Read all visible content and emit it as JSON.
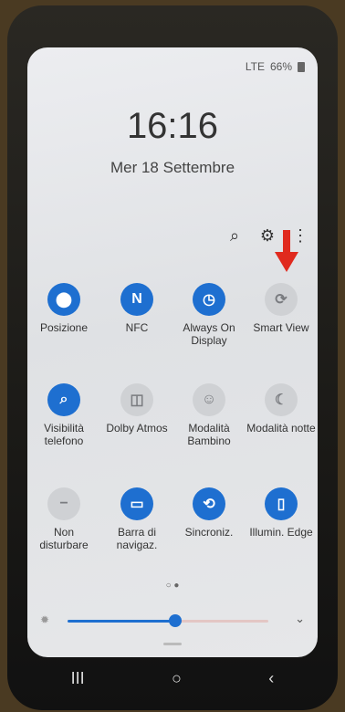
{
  "status_bar": {
    "network": "LTE",
    "battery": "66%"
  },
  "clock": "16:16",
  "date": "Mer 18 Settembre",
  "toolbar": {
    "search_icon": "⌕",
    "settings_icon": "⚙",
    "more_icon": "⋮"
  },
  "tiles": [
    {
      "label": "Posizione",
      "glyph": "⬤",
      "state": "on"
    },
    {
      "label": "NFC",
      "glyph": "N",
      "state": "on"
    },
    {
      "label": "Always On Display",
      "glyph": "◷",
      "state": "on"
    },
    {
      "label": "Smart View",
      "glyph": "⟳",
      "state": "off"
    },
    {
      "label": "Visibilità telefono",
      "glyph": "⌕",
      "state": "on"
    },
    {
      "label": "Dolby Atmos",
      "glyph": "◫",
      "state": "off"
    },
    {
      "label": "Modalità Bambino",
      "glyph": "☺",
      "state": "off"
    },
    {
      "label": "Modalità notte",
      "glyph": "☾",
      "state": "off"
    },
    {
      "label": "Non disturbare",
      "glyph": "−",
      "state": "off"
    },
    {
      "label": "Barra di navigaz.",
      "glyph": "▭",
      "state": "on"
    },
    {
      "label": "Sincroniz.",
      "glyph": "⟲",
      "state": "on"
    },
    {
      "label": "Illumin. Edge",
      "glyph": "▯",
      "state": "on"
    }
  ],
  "page_dots": "○ ●",
  "brightness": {
    "level": 0.48,
    "sun_icon": "✹",
    "expand_icon": "⌄"
  },
  "navbar": {
    "recents": "III",
    "home": "○",
    "back": "‹"
  }
}
